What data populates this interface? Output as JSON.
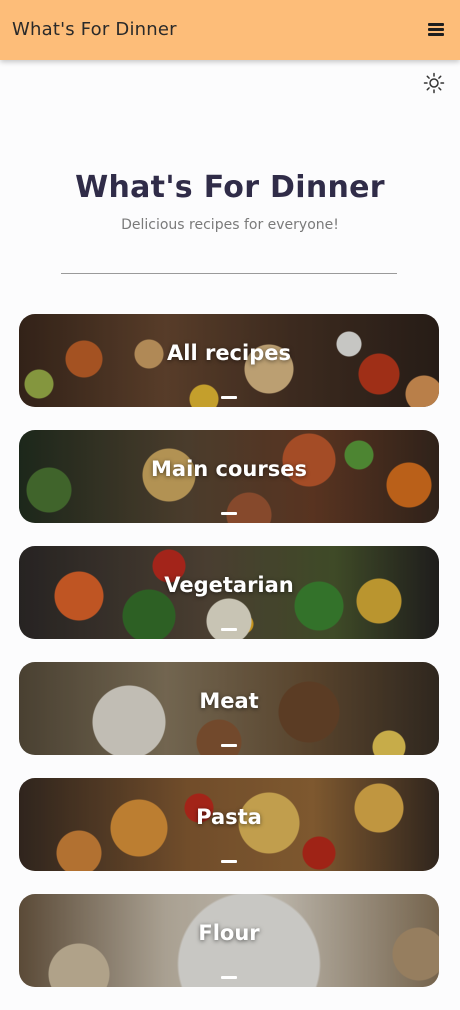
{
  "app_bar": {
    "title": "What's For Dinner",
    "menu_icon": "hamburger-menu-icon",
    "background_color": "#fdbd79"
  },
  "theme_toggle": {
    "icon": "sun-icon"
  },
  "hero": {
    "title": "What's For Dinner",
    "subtitle": "Delicious recipes for everyone!"
  },
  "categories": [
    {
      "label": "All recipes",
      "image": "assorted-dishes"
    },
    {
      "label": "Main courses",
      "image": "grilled-mains"
    },
    {
      "label": "Vegetarian",
      "image": "vegetable-bowl"
    },
    {
      "label": "Meat",
      "image": "meat-plate"
    },
    {
      "label": "Pasta",
      "image": "pasta-dish"
    },
    {
      "label": "Flour",
      "image": "flour-baking"
    }
  ]
}
